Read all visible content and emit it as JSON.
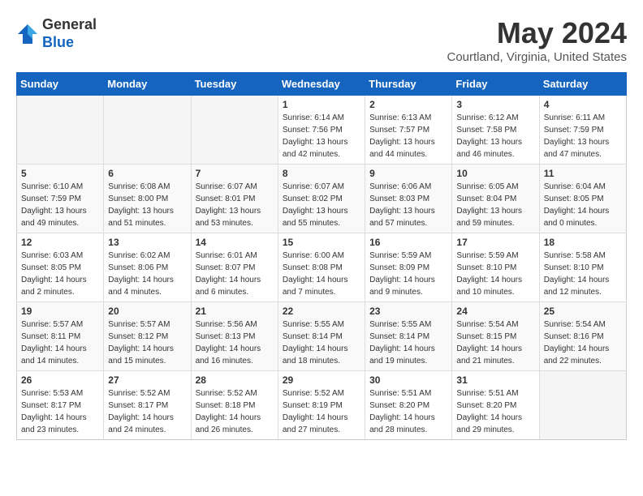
{
  "header": {
    "logo_general": "General",
    "logo_blue": "Blue",
    "month_title": "May 2024",
    "location": "Courtland, Virginia, United States"
  },
  "weekdays": [
    "Sunday",
    "Monday",
    "Tuesday",
    "Wednesday",
    "Thursday",
    "Friday",
    "Saturday"
  ],
  "weeks": [
    [
      {
        "day": "",
        "info": ""
      },
      {
        "day": "",
        "info": ""
      },
      {
        "day": "",
        "info": ""
      },
      {
        "day": "1",
        "info": "Sunrise: 6:14 AM\nSunset: 7:56 PM\nDaylight: 13 hours\nand 42 minutes."
      },
      {
        "day": "2",
        "info": "Sunrise: 6:13 AM\nSunset: 7:57 PM\nDaylight: 13 hours\nand 44 minutes."
      },
      {
        "day": "3",
        "info": "Sunrise: 6:12 AM\nSunset: 7:58 PM\nDaylight: 13 hours\nand 46 minutes."
      },
      {
        "day": "4",
        "info": "Sunrise: 6:11 AM\nSunset: 7:59 PM\nDaylight: 13 hours\nand 47 minutes."
      }
    ],
    [
      {
        "day": "5",
        "info": "Sunrise: 6:10 AM\nSunset: 7:59 PM\nDaylight: 13 hours\nand 49 minutes."
      },
      {
        "day": "6",
        "info": "Sunrise: 6:08 AM\nSunset: 8:00 PM\nDaylight: 13 hours\nand 51 minutes."
      },
      {
        "day": "7",
        "info": "Sunrise: 6:07 AM\nSunset: 8:01 PM\nDaylight: 13 hours\nand 53 minutes."
      },
      {
        "day": "8",
        "info": "Sunrise: 6:07 AM\nSunset: 8:02 PM\nDaylight: 13 hours\nand 55 minutes."
      },
      {
        "day": "9",
        "info": "Sunrise: 6:06 AM\nSunset: 8:03 PM\nDaylight: 13 hours\nand 57 minutes."
      },
      {
        "day": "10",
        "info": "Sunrise: 6:05 AM\nSunset: 8:04 PM\nDaylight: 13 hours\nand 59 minutes."
      },
      {
        "day": "11",
        "info": "Sunrise: 6:04 AM\nSunset: 8:05 PM\nDaylight: 14 hours\nand 0 minutes."
      }
    ],
    [
      {
        "day": "12",
        "info": "Sunrise: 6:03 AM\nSunset: 8:05 PM\nDaylight: 14 hours\nand 2 minutes."
      },
      {
        "day": "13",
        "info": "Sunrise: 6:02 AM\nSunset: 8:06 PM\nDaylight: 14 hours\nand 4 minutes."
      },
      {
        "day": "14",
        "info": "Sunrise: 6:01 AM\nSunset: 8:07 PM\nDaylight: 14 hours\nand 6 minutes."
      },
      {
        "day": "15",
        "info": "Sunrise: 6:00 AM\nSunset: 8:08 PM\nDaylight: 14 hours\nand 7 minutes."
      },
      {
        "day": "16",
        "info": "Sunrise: 5:59 AM\nSunset: 8:09 PM\nDaylight: 14 hours\nand 9 minutes."
      },
      {
        "day": "17",
        "info": "Sunrise: 5:59 AM\nSunset: 8:10 PM\nDaylight: 14 hours\nand 10 minutes."
      },
      {
        "day": "18",
        "info": "Sunrise: 5:58 AM\nSunset: 8:10 PM\nDaylight: 14 hours\nand 12 minutes."
      }
    ],
    [
      {
        "day": "19",
        "info": "Sunrise: 5:57 AM\nSunset: 8:11 PM\nDaylight: 14 hours\nand 14 minutes."
      },
      {
        "day": "20",
        "info": "Sunrise: 5:57 AM\nSunset: 8:12 PM\nDaylight: 14 hours\nand 15 minutes."
      },
      {
        "day": "21",
        "info": "Sunrise: 5:56 AM\nSunset: 8:13 PM\nDaylight: 14 hours\nand 16 minutes."
      },
      {
        "day": "22",
        "info": "Sunrise: 5:55 AM\nSunset: 8:14 PM\nDaylight: 14 hours\nand 18 minutes."
      },
      {
        "day": "23",
        "info": "Sunrise: 5:55 AM\nSunset: 8:14 PM\nDaylight: 14 hours\nand 19 minutes."
      },
      {
        "day": "24",
        "info": "Sunrise: 5:54 AM\nSunset: 8:15 PM\nDaylight: 14 hours\nand 21 minutes."
      },
      {
        "day": "25",
        "info": "Sunrise: 5:54 AM\nSunset: 8:16 PM\nDaylight: 14 hours\nand 22 minutes."
      }
    ],
    [
      {
        "day": "26",
        "info": "Sunrise: 5:53 AM\nSunset: 8:17 PM\nDaylight: 14 hours\nand 23 minutes."
      },
      {
        "day": "27",
        "info": "Sunrise: 5:52 AM\nSunset: 8:17 PM\nDaylight: 14 hours\nand 24 minutes."
      },
      {
        "day": "28",
        "info": "Sunrise: 5:52 AM\nSunset: 8:18 PM\nDaylight: 14 hours\nand 26 minutes."
      },
      {
        "day": "29",
        "info": "Sunrise: 5:52 AM\nSunset: 8:19 PM\nDaylight: 14 hours\nand 27 minutes."
      },
      {
        "day": "30",
        "info": "Sunrise: 5:51 AM\nSunset: 8:20 PM\nDaylight: 14 hours\nand 28 minutes."
      },
      {
        "day": "31",
        "info": "Sunrise: 5:51 AM\nSunset: 8:20 PM\nDaylight: 14 hours\nand 29 minutes."
      },
      {
        "day": "",
        "info": ""
      }
    ]
  ]
}
